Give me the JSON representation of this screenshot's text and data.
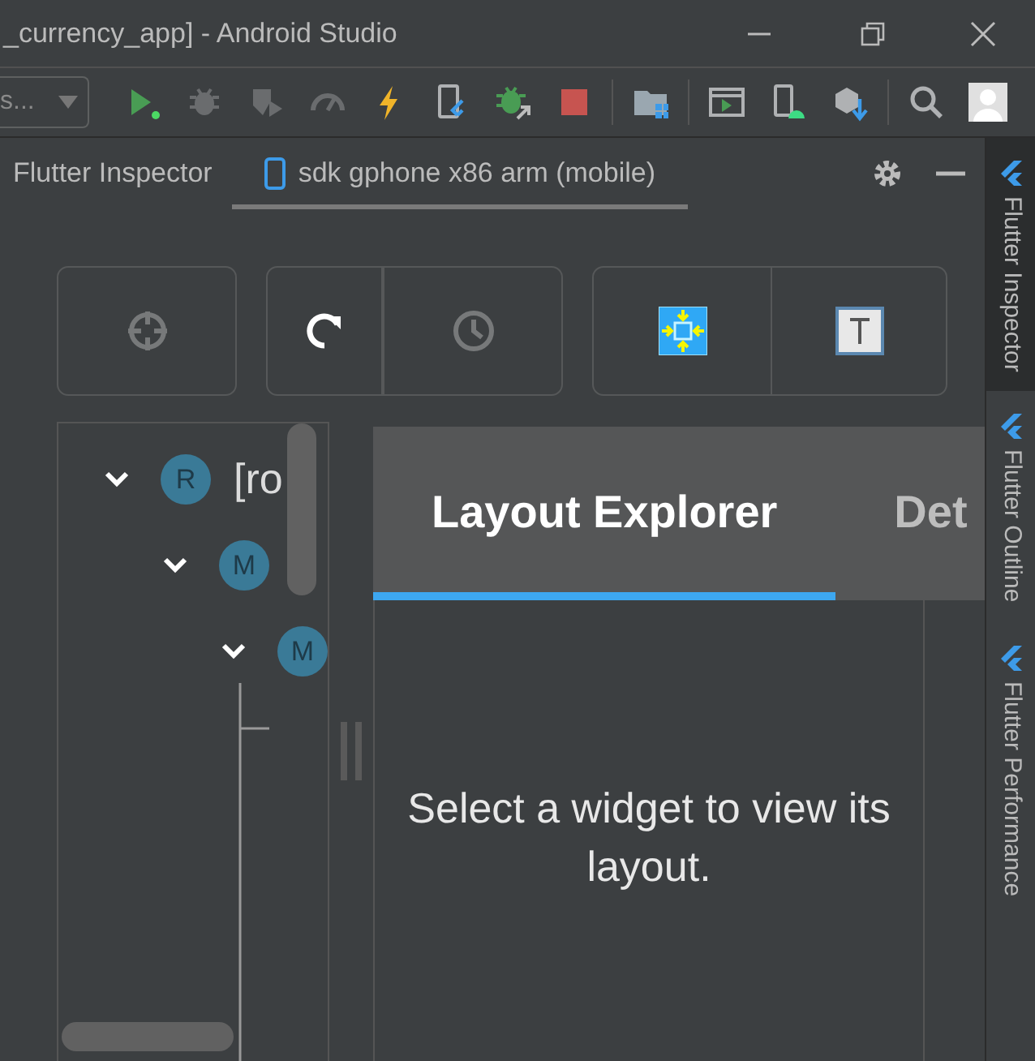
{
  "window": {
    "title": "_currency_app] - Android Studio"
  },
  "toolbar": {
    "config_dropdown": "s...",
    "icons": [
      {
        "kind": "run",
        "disabled": false
      },
      {
        "kind": "debug",
        "disabled": true
      },
      {
        "kind": "coverage",
        "disabled": true
      },
      {
        "kind": "profile",
        "disabled": true
      },
      {
        "kind": "hot-reload",
        "disabled": false
      },
      {
        "kind": "flutter-device",
        "disabled": false
      },
      {
        "kind": "attach-debugger",
        "disabled": false
      },
      {
        "kind": "stop",
        "disabled": false
      },
      {
        "kind": "project-structure",
        "disabled": false
      },
      {
        "kind": "emulator",
        "disabled": false
      },
      {
        "kind": "device-manager",
        "disabled": false
      },
      {
        "kind": "sdk-manager",
        "disabled": false
      },
      {
        "kind": "search",
        "disabled": false
      },
      {
        "kind": "account",
        "disabled": false
      }
    ]
  },
  "tool_window": {
    "title": "Flutter Inspector",
    "device_tab": {
      "label": "sdk gphone x86 arm (mobile)",
      "selected": true
    }
  },
  "inspector_buttons": [
    {
      "kind": "select-widget",
      "disabled": true
    },
    {
      "kind": "refresh",
      "disabled": false
    },
    {
      "kind": "history",
      "disabled": true
    },
    {
      "kind": "debug-paint",
      "disabled": false
    },
    {
      "kind": "text-baseline",
      "disabled": false
    }
  ],
  "widget_tree": [
    {
      "badge": "R",
      "label": "[ro",
      "expanded": true,
      "children": [
        {
          "badge": "M",
          "expanded": true,
          "children": [
            {
              "badge": "M",
              "expanded": true
            }
          ]
        }
      ]
    }
  ],
  "details_tabs": [
    {
      "label": "Layout Explorer",
      "selected": true
    },
    {
      "label": "Det",
      "selected": false
    }
  ],
  "details_message": "Select a widget to view its layout.",
  "side_tabs": [
    {
      "label": "Flutter Inspector",
      "selected": true
    },
    {
      "label": "Flutter Outline",
      "selected": false
    },
    {
      "label": "Flutter Performance",
      "selected": false
    }
  ]
}
